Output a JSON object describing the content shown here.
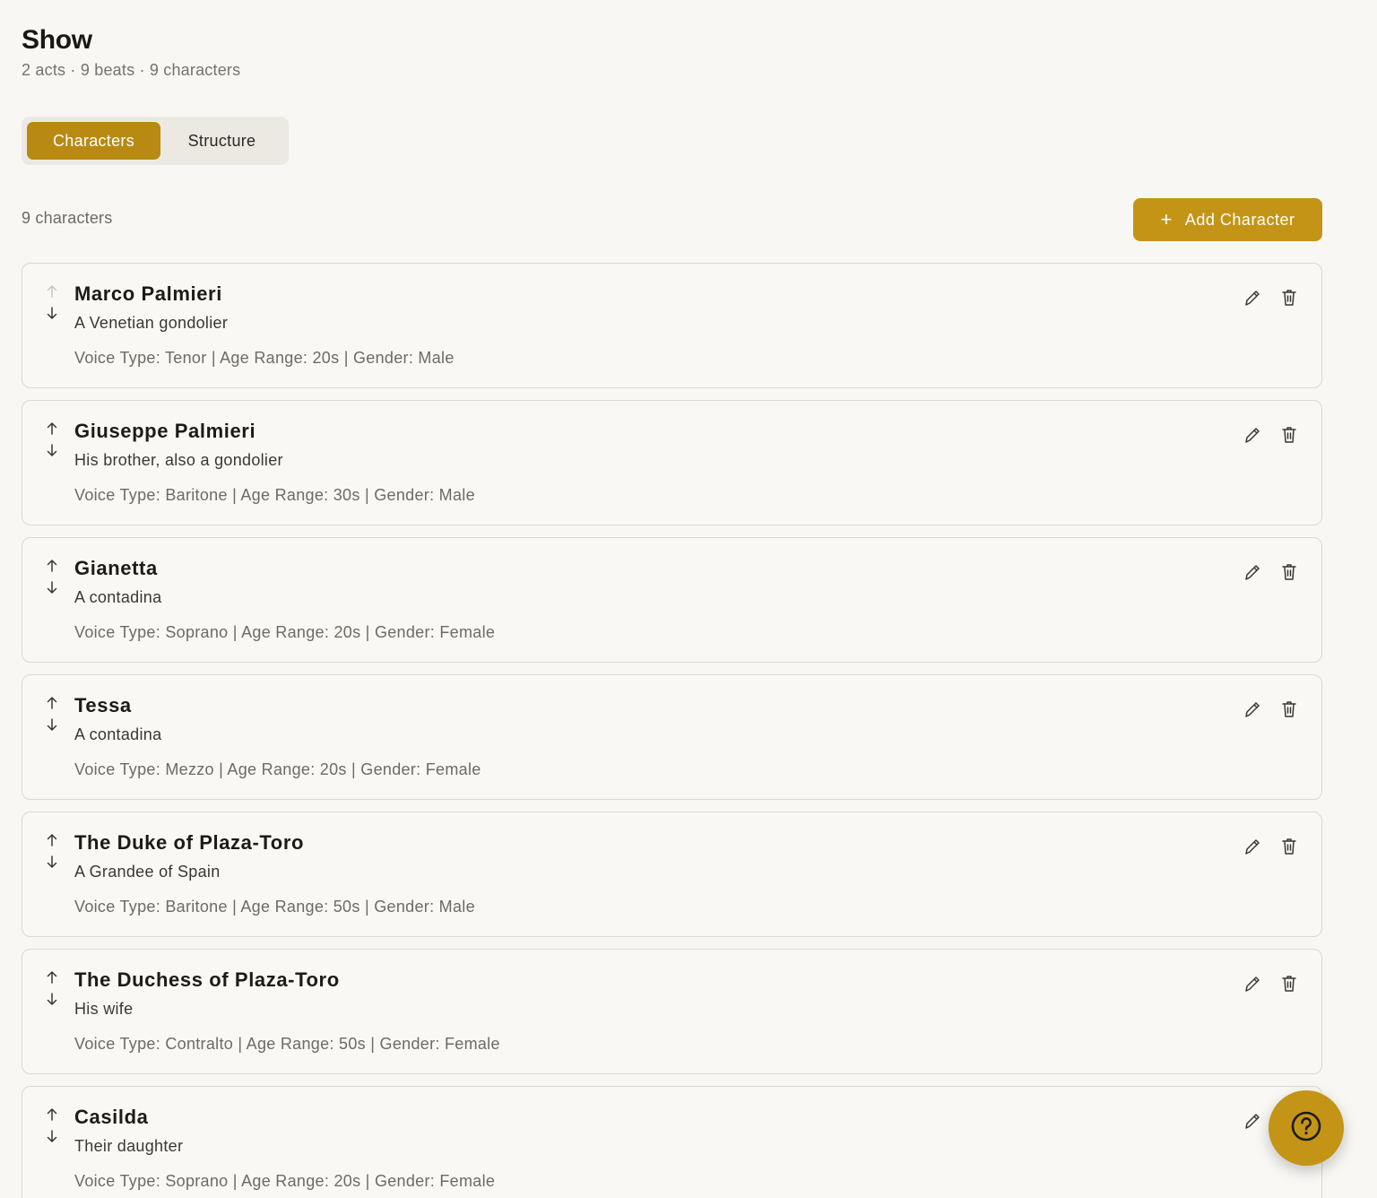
{
  "header": {
    "title": "Show",
    "subtitle": "2 acts · 9 beats · 9 characters"
  },
  "tabs": [
    {
      "label": "Characters",
      "active": true
    },
    {
      "label": "Structure",
      "active": false
    }
  ],
  "characters_section": {
    "count_label": "9 characters",
    "add_button_label": "Add Character"
  },
  "characters": [
    {
      "name": "Marco Palmieri",
      "description": "A Venetian gondolier",
      "meta": "Voice Type: Tenor | Age Range: 20s | Gender: Male",
      "can_move_up": false
    },
    {
      "name": "Giuseppe Palmieri",
      "description": "His brother, also a gondolier",
      "meta": "Voice Type: Baritone | Age Range: 30s | Gender: Male",
      "can_move_up": true
    },
    {
      "name": "Gianetta",
      "description": "A contadina",
      "meta": "Voice Type: Soprano | Age Range: 20s | Gender: Female",
      "can_move_up": true
    },
    {
      "name": "Tessa",
      "description": "A contadina",
      "meta": "Voice Type: Mezzo | Age Range: 20s | Gender: Female",
      "can_move_up": true
    },
    {
      "name": "The Duke of Plaza-Toro",
      "description": "A Grandee of Spain",
      "meta": "Voice Type: Baritone | Age Range: 50s | Gender: Male",
      "can_move_up": true
    },
    {
      "name": "The Duchess of Plaza-Toro",
      "description": "His wife",
      "meta": "Voice Type: Contralto | Age Range: 50s | Gender: Female",
      "can_move_up": true
    },
    {
      "name": "Casilda",
      "description": "Their daughter",
      "meta": "Voice Type: Soprano | Age Range: 20s | Gender: Female",
      "can_move_up": true
    }
  ],
  "icons": {
    "move_up": "arrow-up-icon",
    "move_down": "arrow-down-icon",
    "edit": "pencil-icon",
    "delete": "trash-icon",
    "help": "question-circle-icon",
    "add": "plus-icon"
  },
  "colors": {
    "accent": "#c49416",
    "accent_active_tab": "#b88a11",
    "background": "#f8f7f4",
    "card_border": "#dcd8d1"
  }
}
